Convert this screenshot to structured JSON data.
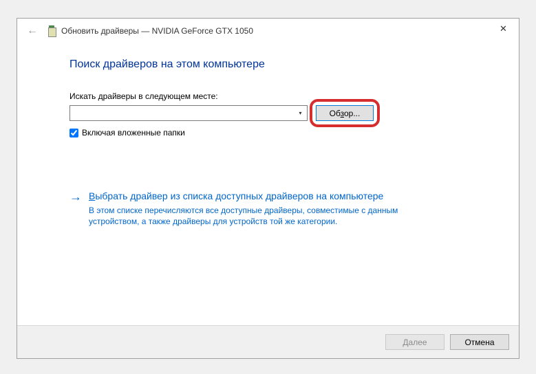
{
  "titlebar": {
    "title": "Обновить драйверы — NVIDIA GeForce GTX 1050"
  },
  "content": {
    "heading": "Поиск драйверов на этом компьютере",
    "search_label": "Искать драйверы в следующем месте:",
    "path_value": "",
    "browse_label": "Обзор...",
    "include_subfolders_label": "Включая вложенные папки",
    "include_subfolders_checked": true,
    "link_title": "Выбрать драйвер из списка доступных драйверов на компьютере",
    "link_description": "В этом списке перечисляются все доступные драйверы, совместимые с данным устройством, а также драйверы для устройств той же категории."
  },
  "footer": {
    "next_label": "Далее",
    "cancel_label": "Отмена"
  }
}
